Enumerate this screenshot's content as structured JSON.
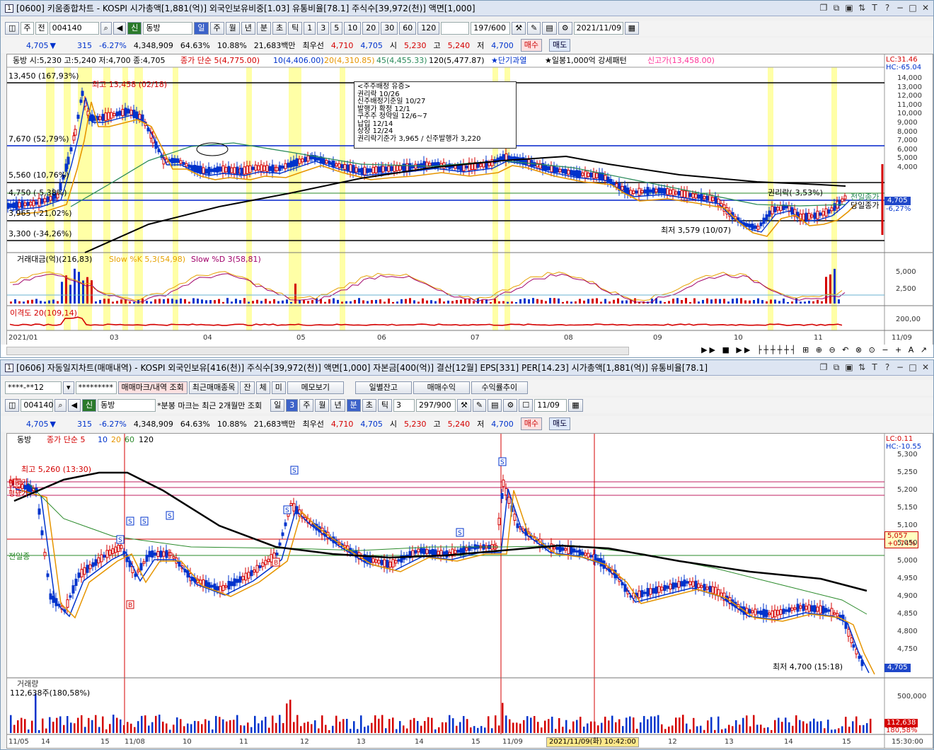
{
  "top": {
    "title": "[0600] 키움종합차트 - KOSPI 시가총액[1,881(억)] 외국인보유비중[1.03] 유통비율[78.1] 주식수[39,972(천)] 액면[1,000]",
    "toolbar": {
      "period": "주",
      "prev": "전",
      "code": "004140",
      "new_badge": "신",
      "name": "동방",
      "periods": [
        "일",
        "주",
        "월",
        "년",
        "분",
        "초",
        "틱"
      ],
      "mins": [
        "1",
        "3",
        "5",
        "10",
        "20",
        "30",
        "60",
        "120"
      ],
      "count": "197/600",
      "date": "2021/11/09"
    },
    "price": {
      "price": "4,705",
      "change": "315",
      "rate": "-6.27%",
      "volume": "4,348,909",
      "ratio": "64.63%",
      "turnover": "10.88%",
      "amount": "21,683백만",
      "best_label": "최우선",
      "ask": "4,710",
      "bid": "4,705",
      "open_label": "시",
      "open": "5,230",
      "high_label": "고",
      "high": "5,240",
      "low_label": "저",
      "low": "4,700",
      "buy": "매수",
      "sell": "매도"
    },
    "legend": {
      "ohlc": "동방 시:5,230 고:5,240 저:4,700 종:4,705",
      "ma_label": "종가 단순 5(4,775.00)",
      "ma10": "10(4,406.00)",
      "ma20": "20(4,310.85)",
      "ma45": "45(4,455.33)",
      "ma120": "120(5,477.87)",
      "s1": "★단기과열",
      "s2": "★일봉1,000억 강세패턴",
      "s3": "신고가(13,458.00)",
      "lc": "LC:31.46",
      "hc": "HC:-65.04"
    },
    "levels": [
      "13,450 (167,93%)",
      "7,670 (52,79%)",
      "5,560 (10,76%)",
      "4,750 (-5,38%)",
      "3,965 (-21,02%)",
      "3,300 (-34,26%)"
    ],
    "yticks": [
      "14,000",
      "13,000",
      "12,000",
      "11,000",
      "10,000",
      "9,000",
      "8,000",
      "7,000",
      "6,000",
      "5,000",
      "4,000"
    ],
    "annot": {
      "high": "최고 13,458 (02/18)",
      "low": "최저 3,579 (10/07)",
      "ex": "권리락(-3,53%)",
      "prev_close": "전일종가",
      "today_close": "당일종가",
      "cur": "4,705",
      "cur_rate": "-6,27%"
    },
    "notice": [
      "<주주배정 유증>",
      "권리락 10/26",
      "신주배정기준일 10/27",
      "발행가 확정 12/1",
      "구주주 청약일 12/6~7",
      "납입 12/14",
      "상장 12/24",
      "권리락기준가 3,965 / 신주발행가 3,220"
    ],
    "sub1": {
      "label": "거래대금(억)(216,83)",
      "k": "Slow %K 5,3(54,98)",
      "d": "Slow %D 3(58,81)",
      "ticks": [
        "5,000",
        "2,500"
      ]
    },
    "sub2": {
      "label": "이격도 20(109,14)",
      "tick": "200,00"
    },
    "xdates": [
      "2021/01",
      "03",
      "04",
      "05",
      "06",
      "07",
      "08",
      "09",
      "10",
      "11",
      "11/09"
    ]
  },
  "bottom": {
    "title": "[0606] 자동일지차트(매매내역) - KOSPI 외국인보유[416(천)] 주식수[39,972(천)] 액면[1,000] 자본금[400(억)] 결산[12월] EPS[331] PER[14.23] 시가총액[1,881(억)] 유통비율[78.1]",
    "acct": "****-**12",
    "pw": "*********",
    "buttons": [
      "매매마크/내역 조회",
      "최근매매종목",
      "잔",
      "체",
      "미",
      "메모보기",
      "일별잔고",
      "매매수익",
      "수익률추이"
    ],
    "code": "004140",
    "new_badge": "신",
    "name": "동방",
    "note": "*분봉 마크는 최근 2개월만 조회",
    "periods": [
      "일",
      "3",
      "주",
      "월",
      "년",
      "분",
      "초",
      "틱",
      "3"
    ],
    "count": "297/900",
    "date": "11/09",
    "price": {
      "price": "4,705",
      "change": "315",
      "rate": "-6.27%",
      "volume": "4,348,909",
      "ratio": "64.63%",
      "turnover": "10.88%",
      "amount": "21,683백만",
      "best_label": "최우선",
      "ask": "4,710",
      "bid": "4,705",
      "open_label": "시",
      "open": "5,230",
      "high_label": "고",
      "high": "5,240",
      "low_label": "저",
      "low": "4,700",
      "buy": "매수",
      "sell": "매도"
    },
    "legend": {
      "name": "동방",
      "ma_label": "종가 단순 5",
      "m10": "10",
      "m20": "20",
      "m60": "60",
      "m120": "120",
      "lc": "LC:0.11",
      "hc": "HC:-10.55"
    },
    "yticks": [
      "5,300",
      "5,250",
      "5,200",
      "5,150",
      "5,100",
      "5,050",
      "5,000",
      "4,950",
      "4,900",
      "4,850",
      "4,800",
      "4,750"
    ],
    "annot": {
      "high": "최고 5,260 (13:30)",
      "low": "최저 4,700 (15:18)",
      "prev_close": "전일종",
      "cur": "5,057",
      "cur_rate": "+0.74%",
      "last": "4,705",
      "left1": "매매가",
      "left2": "평균가"
    },
    "vol": {
      "label": "거래량",
      "value": "112,638주(180,58%)",
      "tick": "500,000",
      "cur": "112,638",
      "cur_rate": "180,58%"
    },
    "xdates": [
      "11/05",
      "14",
      "15",
      "11/08",
      "10",
      "11",
      "12",
      "13",
      "14",
      "15",
      "11/09",
      "10",
      "11",
      "12",
      "13",
      "14",
      "15",
      "15:30:00"
    ],
    "cursor": "2021/11/09(화) 10:42:00"
  }
}
